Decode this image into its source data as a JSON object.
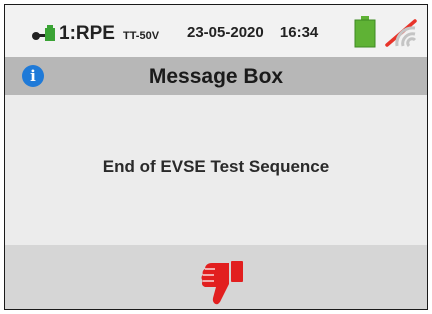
{
  "status": {
    "mode": "1:RPE",
    "system": "TT-50V",
    "date": "23-05-2020",
    "time": "16:34",
    "battery_color": "#5fb235",
    "wifi_slash_color": "#e8342a"
  },
  "dialog": {
    "title": "Message Box",
    "info_icon_glyph": "i",
    "message": "End of EVSE Test Sequence",
    "result_icon": "thumbs-down-icon",
    "result_color": "#e21f1f"
  }
}
